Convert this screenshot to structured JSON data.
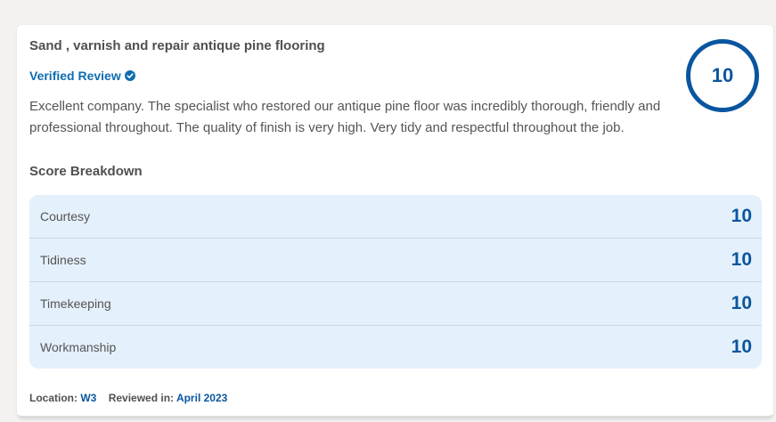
{
  "review": {
    "title": "Sand , varnish and repair antique pine flooring",
    "verified_label": "Verified Review",
    "overall_score": "10",
    "text": "Excellent company. The specialist who restored our antique pine floor was incredibly thorough, friendly and professional throughout. The quality of finish is very high. Very tidy and respectful throughout the job."
  },
  "breakdown": {
    "title": "Score Breakdown",
    "rows": [
      {
        "label": "Courtesy",
        "score": "10"
      },
      {
        "label": "Tidiness",
        "score": "10"
      },
      {
        "label": "Timekeeping",
        "score": "10"
      },
      {
        "label": "Workmanship",
        "score": "10"
      }
    ]
  },
  "footer": {
    "location_label": "Location:",
    "location_value": "W3",
    "reviewed_label": "Reviewed in:",
    "reviewed_value": "April 2023"
  },
  "colors": {
    "accent": "#0a559f",
    "link": "#0f6cb0",
    "breakdown_bg": "#e4f0fb"
  },
  "icons": {
    "verified": "verified-check-badge-icon"
  }
}
